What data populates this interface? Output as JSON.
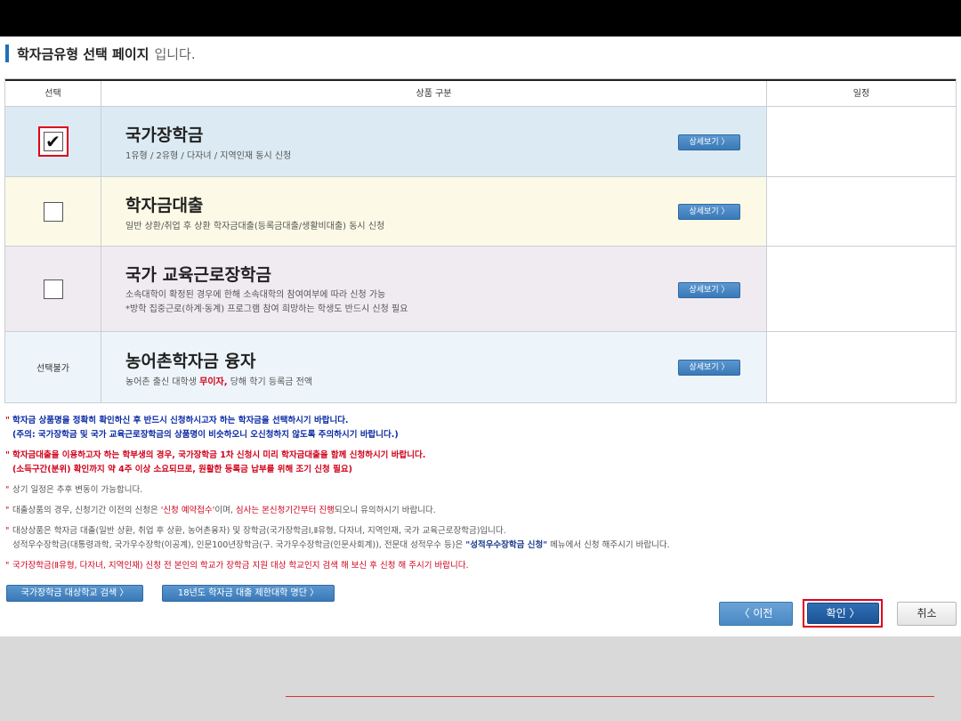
{
  "page": {
    "title_strong": "학자금유형 선택 페이지",
    "title_weak": "입니다."
  },
  "table": {
    "headers": {
      "select": "선택",
      "product": "상품 구분",
      "schedule": "일정"
    },
    "rows": [
      {
        "name": "국가장학금",
        "desc_lines": [
          "1유형 / 2유형 / 다자녀 / 지역인재 동시 신청"
        ],
        "checked": true,
        "detail_label": "상세보기 〉",
        "schedule": ""
      },
      {
        "name": "학자금대출",
        "desc_lines": [
          "일반 상환/취업 후 상환 학자금대출(등록금대출/생활비대출) 동시 신청"
        ],
        "checked": false,
        "detail_label": "상세보기 〉",
        "schedule": ""
      },
      {
        "name": "국가 교육근로장학금",
        "desc_lines": [
          "소속대학이 확정된 경우에 한해 소속대학의 참여여부에 따라 신청 가능",
          "*방학 집중근로(하계·동계) 프로그램 참여 희망하는 학생도 반드시 신청 필요"
        ],
        "checked": false,
        "detail_label": "상세보기 〉",
        "schedule": ""
      },
      {
        "name": "농어촌학자금 융자",
        "desc_pre": "농어촌 출신 대학생 ",
        "desc_hl": "무이자,",
        "desc_post": " 당해 학기 등록금 전액",
        "select_text": "선택불가",
        "detail_label": "상세보기 〉",
        "schedule": ""
      }
    ]
  },
  "notes": {
    "n1_line1": "학자금 상품명을 정확히 확인하신 후 반드시 신청하시고자 하는 학자금을 선택하시기 바랍니다.",
    "n1_line2": "(주의: 국가장학금 및 국가 교육근로장학금의 상품명이 비슷하오니 오신청하지 않도록 주의하시기 바랍니다.)",
    "n2_line1": "학자금대출을 이용하고자 하는 학부생의 경우, 국가장학금 1차 신청시 미리 학자금대출을 함께 신청하시기 바랍니다.",
    "n2_line2": "(소득구간(분위) 확인까지 약 4주 이상 소요되므로, 원활한 등록금 납부를 위해 조기 신청 필요)",
    "n3": "상기 일정은 추후 변동이 가능합니다.",
    "n4_pre": "대출상품의 경우, 신청기간 이전의 신청은 ",
    "n4_hl1": "'신청 예약접수'",
    "n4_mid": "이며, ",
    "n4_hl2": "심사는 본신청기간부터 진행",
    "n4_post": "되오니 유의하시기 바랍니다.",
    "n5_line1": "대상상품은 학자금 대출(일반 상환, 취업 후 상환, 농어촌융자) 및 장학금(국가장학금Ⅰ,Ⅱ유형, 다자녀, 지역인재, 국가 교육근로장학금)입니다.",
    "n5_line2_pre": "성적우수장학금(대통령과학, 국가우수장학(이공계), 인문100년장학금(구. 국가우수장학금(인문사회계)), 전문대 성적우수 등)은 ",
    "n5_line2_hl": "\"성적우수장학금 신청\"",
    "n5_line2_post": " 메뉴에서 신청 해주시기 바랍니다.",
    "n6": "국가장학금(Ⅱ유형, 다자녀, 지역인재) 신청 전 본인의 학교가 장학금 지원 대상 학교인지 검색 해 보신 후 신청 해 주시기 바랍니다."
  },
  "links": {
    "school_search": "국가장학금 대상학교 검색 〉",
    "restricted_univ": "18년도 학자금 대출 제한대학 명단 〉"
  },
  "buttons": {
    "prev": "〈  이전",
    "ok": "확인  〉",
    "cancel": "취소"
  },
  "colors": {
    "accent_blue": "#1f6fb8",
    "highlight_red": "#e0001a",
    "row1_bg": "#dcebf3",
    "row2_bg": "#fcfae6",
    "row3_bg": "#f0ebf1",
    "row4_bg": "#eef5fa"
  }
}
